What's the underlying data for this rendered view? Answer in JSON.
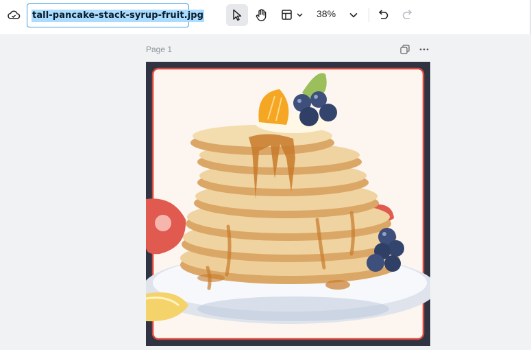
{
  "toolbar": {
    "cloud_icon": "cloud-sync-icon",
    "filename": "tall-pancake-stack-syrup-fruit.jpg",
    "select_icon": "cursor-arrow-icon",
    "hand_icon": "hand-pan-icon",
    "layout_icon": "layout-panel-icon",
    "zoom": "38%",
    "undo_icon": "undo-icon",
    "redo_icon": "redo-icon"
  },
  "page": {
    "label": "Page 1",
    "copy_icon": "duplicate-page-icon",
    "more_icon": "more-horizontal-icon"
  },
  "canvas": {
    "image_alt": "Watercolor illustration of a tall stack of pancakes with syrup, blueberries, orange slice, strawberries and lemon on a white plate",
    "colors": {
      "frame": "#2f3342",
      "border": "#d9473a",
      "background": "#fdf5ef",
      "pancake": "#e9c08a",
      "syrup": "#c77a2a",
      "blueberry": "#3d4f7a"
    }
  }
}
